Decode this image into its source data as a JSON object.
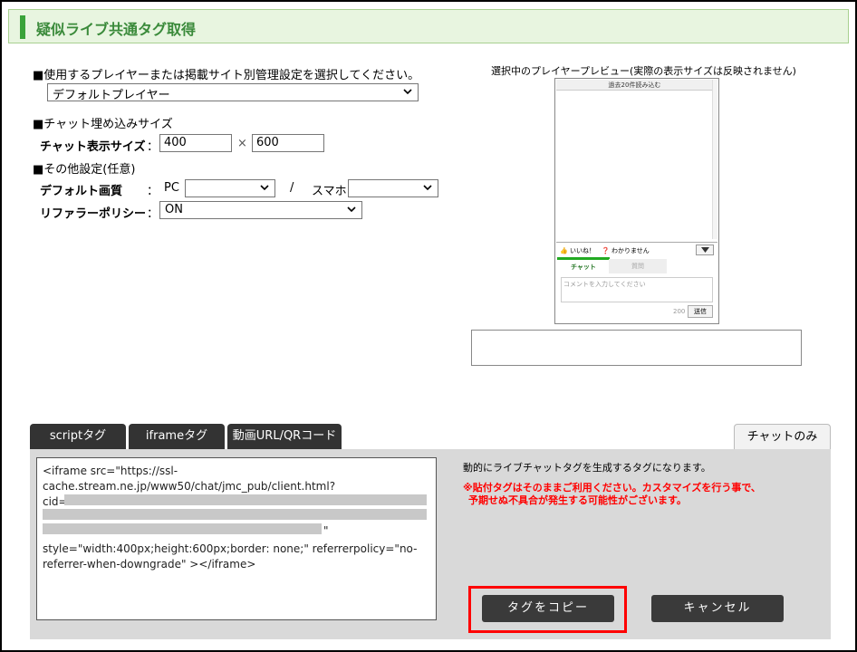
{
  "header": {
    "title": "疑似ライブ共通タグ取得"
  },
  "settings": {
    "player_section": "■使用するプレイヤーまたは掲載サイト別管理設定を選択してください。",
    "player_select": "デフォルトプレイヤー",
    "size_section": "■チャット埋め込みサイズ",
    "size_label": "チャット表示サイズ",
    "colon": "：",
    "width": "400",
    "times": "×",
    "height": "600",
    "other_section": "■その他設定(任意)",
    "quality_label": "デフォルト画質",
    "pc_label": "PC",
    "pc_value": "",
    "slash": "/",
    "sp_label": "スマホ",
    "sp_value": "",
    "referrer_label": "リファラーポリシー",
    "referrer_value": "ON"
  },
  "preview": {
    "title": "選択中のプレイヤープレビュー(実際の表示サイズは反映されません)",
    "load_more": "過去20件読み込む",
    "like": "いいね！",
    "dunno": "わかりません",
    "tab_chat": "チャット",
    "tab_question": "質問",
    "comment_placeholder": "コメントを入力してください",
    "count": "200",
    "send": "送信"
  },
  "tabs": {
    "script": "scriptタグ",
    "iframe": "iframeタグ",
    "url": "動画URL/QRコード",
    "chat_only": "チャットのみ"
  },
  "code": {
    "line1": "<iframe src=\"https://ssl-",
    "line2": "cache.stream.ne.jp/www50/chat/jmc_pub/client.html?",
    "line3": "cid=",
    "quote": "\"",
    "line4": " style=\"width:400px;height:600px;border: none;\" referrerpolicy=\"no-",
    "line5": "referrer-when-downgrade\" ></iframe>"
  },
  "description": {
    "text": "動的にライブチャットタグを生成するタグになります。",
    "warning1": "※貼付タグはそのままご利用ください。カスタマイズを行う事で、",
    "warning2": "予期せぬ不具合が発生する可能性がございます。"
  },
  "buttons": {
    "copy": "タグをコピー",
    "cancel": "キャンセル"
  },
  "colors": {
    "accent": "#3aa33a",
    "header_bg": "#e8f5e0",
    "button": "#3a3a3a",
    "highlight": "#ff0000"
  }
}
